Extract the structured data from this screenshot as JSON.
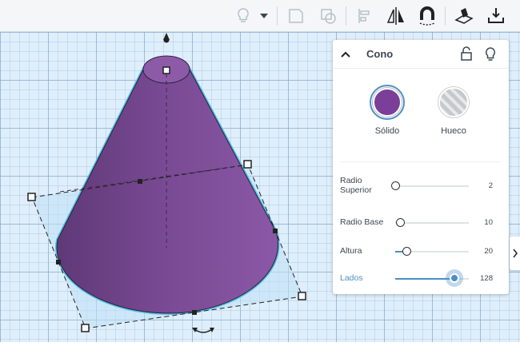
{
  "panel": {
    "title": "Cono",
    "solid_label": "Sólido",
    "hole_label": "Hueco",
    "properties": [
      {
        "label_line1": "Radio",
        "label_line2": "Superior",
        "value": "2",
        "fraction": 0.0
      },
      {
        "label_line1": "Radio Base",
        "label_line2": "",
        "value": "10",
        "fraction": 0.07
      },
      {
        "label_line1": "Altura",
        "label_line2": "",
        "value": "20",
        "fraction": 0.15
      },
      {
        "label_line1": "Lados",
        "label_line2": "",
        "value": "128",
        "fraction": 0.8
      }
    ]
  },
  "colors": {
    "shape": "#7b4a96",
    "solid_swatch": "#7b3f99",
    "accent": "#4a90c8",
    "selection_outline": "#4fc3e0"
  },
  "icons": {
    "toolbar": [
      "lightbulb-icon",
      "dropdown-arrow-icon",
      "group-icon",
      "ungroup-icon",
      "align-icon",
      "mirror-icon",
      "magnet-icon",
      "workplane-icon",
      "ruler-drop-icon"
    ],
    "panel": [
      "chevron-up-icon",
      "lock-icon",
      "lightbulb-icon"
    ]
  }
}
